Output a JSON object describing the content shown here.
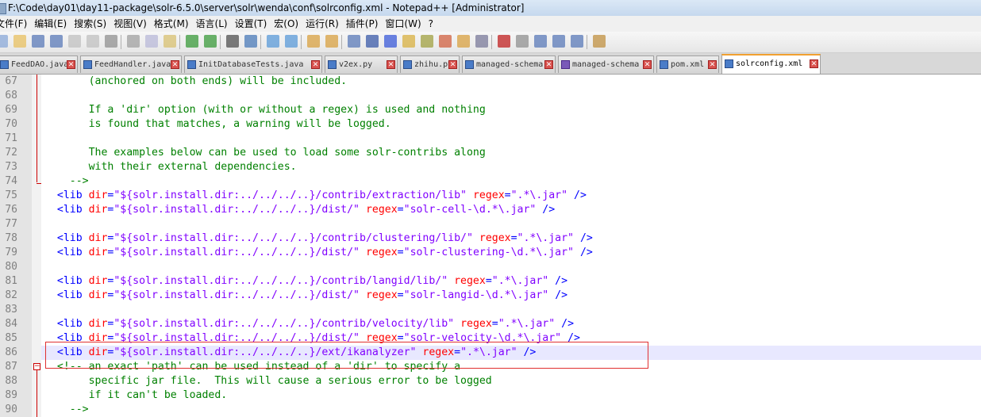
{
  "window": {
    "title": "F:\\Code\\day01\\day11-package\\solr-6.5.0\\server\\solr\\wenda\\conf\\solrconfig.xml - Notepad++ [Administrator]"
  },
  "menu": [
    "文件(F)",
    "编辑(E)",
    "搜索(S)",
    "视图(V)",
    "格式(M)",
    "语言(L)",
    "设置(T)",
    "宏(O)",
    "运行(R)",
    "插件(P)",
    "窗口(W)",
    "?"
  ],
  "toolbar": {
    "icons": [
      "new-file-icon",
      "open-file-icon",
      "save-icon",
      "save-all-icon",
      "close-icon",
      "close-all-icon",
      "print-icon",
      "cut-icon",
      "copy-icon",
      "paste-icon",
      "undo-icon",
      "redo-icon",
      "find-icon",
      "replace-icon",
      "zoom-in-icon",
      "zoom-out-icon",
      "sync-v-icon",
      "sync-h-icon",
      "wrap-icon",
      "all-chars-icon",
      "indent-guide-icon",
      "user-lang-icon",
      "doc-map-icon",
      "function-list-icon",
      "folder-workspace-icon",
      "monitor-icon",
      "record-macro-icon",
      "stop-macro-icon",
      "play-macro-icon",
      "run-macro-icon",
      "save-macro-icon",
      "trim-icon"
    ]
  },
  "tabs": [
    {
      "label": "FeedDAO.java",
      "icon": "save-icon"
    },
    {
      "label": "FeedHandler.java",
      "icon": "save-icon"
    },
    {
      "label": "InitDatabaseTests.java",
      "icon": "save-icon"
    },
    {
      "label": "v2ex.py",
      "icon": "save-icon"
    },
    {
      "label": "zhihu.py",
      "icon": "save-icon"
    },
    {
      "label": "managed-schema",
      "icon": "save-icon"
    },
    {
      "label": "managed-schema",
      "icon": "unsaved-icon"
    },
    {
      "label": "pom.xml",
      "icon": "save-icon"
    },
    {
      "label": "solrconfig.xml",
      "icon": "save-icon"
    }
  ],
  "editor": {
    "lines": [
      {
        "n": "67",
        "segs": [
          {
            "k": "c",
            "t": "       (anchored on both ends) will be included."
          }
        ]
      },
      {
        "n": "68",
        "segs": [
          {
            "k": "c",
            "t": ""
          }
        ]
      },
      {
        "n": "69",
        "segs": [
          {
            "k": "c",
            "t": "       If a 'dir' option (with or without a regex) is used and nothing"
          }
        ]
      },
      {
        "n": "70",
        "segs": [
          {
            "k": "c",
            "t": "       is found that matches, a warning will be logged."
          }
        ]
      },
      {
        "n": "71",
        "segs": [
          {
            "k": "c",
            "t": ""
          }
        ]
      },
      {
        "n": "72",
        "segs": [
          {
            "k": "c",
            "t": "       The examples below can be used to load some solr-contribs along"
          }
        ]
      },
      {
        "n": "73",
        "segs": [
          {
            "k": "c",
            "t": "       with their external dependencies."
          }
        ]
      },
      {
        "n": "74",
        "segs": [
          {
            "k": "c",
            "t": "    -->"
          }
        ]
      },
      {
        "n": "75",
        "segs": [
          {
            "k": "t",
            "t": "  <lib "
          },
          {
            "k": "a",
            "t": "dir"
          },
          {
            "k": "t",
            "t": "="
          },
          {
            "k": "v",
            "t": "\"${solr.install.dir:../../../..}/contrib/extraction/lib\""
          },
          {
            "k": "t",
            "t": " "
          },
          {
            "k": "a",
            "t": "regex"
          },
          {
            "k": "t",
            "t": "="
          },
          {
            "k": "v",
            "t": "\".*\\.jar\""
          },
          {
            "k": "t",
            "t": " />"
          }
        ]
      },
      {
        "n": "76",
        "segs": [
          {
            "k": "t",
            "t": "  <lib "
          },
          {
            "k": "a",
            "t": "dir"
          },
          {
            "k": "t",
            "t": "="
          },
          {
            "k": "v",
            "t": "\"${solr.install.dir:../../../..}/dist/\""
          },
          {
            "k": "t",
            "t": " "
          },
          {
            "k": "a",
            "t": "regex"
          },
          {
            "k": "t",
            "t": "="
          },
          {
            "k": "v",
            "t": "\"solr-cell-\\d.*\\.jar\""
          },
          {
            "k": "t",
            "t": " />"
          }
        ]
      },
      {
        "n": "77",
        "segs": [
          {
            "k": "t",
            "t": ""
          }
        ]
      },
      {
        "n": "78",
        "segs": [
          {
            "k": "t",
            "t": "  <lib "
          },
          {
            "k": "a",
            "t": "dir"
          },
          {
            "k": "t",
            "t": "="
          },
          {
            "k": "v",
            "t": "\"${solr.install.dir:../../../..}/contrib/clustering/lib/\""
          },
          {
            "k": "t",
            "t": " "
          },
          {
            "k": "a",
            "t": "regex"
          },
          {
            "k": "t",
            "t": "="
          },
          {
            "k": "v",
            "t": "\".*\\.jar\""
          },
          {
            "k": "t",
            "t": " />"
          }
        ]
      },
      {
        "n": "79",
        "segs": [
          {
            "k": "t",
            "t": "  <lib "
          },
          {
            "k": "a",
            "t": "dir"
          },
          {
            "k": "t",
            "t": "="
          },
          {
            "k": "v",
            "t": "\"${solr.install.dir:../../../..}/dist/\""
          },
          {
            "k": "t",
            "t": " "
          },
          {
            "k": "a",
            "t": "regex"
          },
          {
            "k": "t",
            "t": "="
          },
          {
            "k": "v",
            "t": "\"solr-clustering-\\d.*\\.jar\""
          },
          {
            "k": "t",
            "t": " />"
          }
        ]
      },
      {
        "n": "80",
        "segs": [
          {
            "k": "t",
            "t": ""
          }
        ]
      },
      {
        "n": "81",
        "segs": [
          {
            "k": "t",
            "t": "  <lib "
          },
          {
            "k": "a",
            "t": "dir"
          },
          {
            "k": "t",
            "t": "="
          },
          {
            "k": "v",
            "t": "\"${solr.install.dir:../../../..}/contrib/langid/lib/\""
          },
          {
            "k": "t",
            "t": " "
          },
          {
            "k": "a",
            "t": "regex"
          },
          {
            "k": "t",
            "t": "="
          },
          {
            "k": "v",
            "t": "\".*\\.jar\""
          },
          {
            "k": "t",
            "t": " />"
          }
        ]
      },
      {
        "n": "82",
        "segs": [
          {
            "k": "t",
            "t": "  <lib "
          },
          {
            "k": "a",
            "t": "dir"
          },
          {
            "k": "t",
            "t": "="
          },
          {
            "k": "v",
            "t": "\"${solr.install.dir:../../../..}/dist/\""
          },
          {
            "k": "t",
            "t": " "
          },
          {
            "k": "a",
            "t": "regex"
          },
          {
            "k": "t",
            "t": "="
          },
          {
            "k": "v",
            "t": "\"solr-langid-\\d.*\\.jar\""
          },
          {
            "k": "t",
            "t": " />"
          }
        ]
      },
      {
        "n": "83",
        "segs": [
          {
            "k": "t",
            "t": ""
          }
        ]
      },
      {
        "n": "84",
        "segs": [
          {
            "k": "t",
            "t": "  <lib "
          },
          {
            "k": "a",
            "t": "dir"
          },
          {
            "k": "t",
            "t": "="
          },
          {
            "k": "v",
            "t": "\"${solr.install.dir:../../../..}/contrib/velocity/lib\""
          },
          {
            "k": "t",
            "t": " "
          },
          {
            "k": "a",
            "t": "regex"
          },
          {
            "k": "t",
            "t": "="
          },
          {
            "k": "v",
            "t": "\".*\\.jar\""
          },
          {
            "k": "t",
            "t": " />"
          }
        ]
      },
      {
        "n": "85",
        "segs": [
          {
            "k": "t",
            "t": "  <lib "
          },
          {
            "k": "a",
            "t": "dir"
          },
          {
            "k": "t",
            "t": "="
          },
          {
            "k": "v",
            "t": "\"${solr.install.dir:../../../..}/dist/\""
          },
          {
            "k": "t",
            "t": " "
          },
          {
            "k": "a",
            "t": "regex"
          },
          {
            "k": "t",
            "t": "="
          },
          {
            "k": "v",
            "t": "\"solr-velocity-\\d.*\\.jar\""
          },
          {
            "k": "t",
            "t": " />"
          }
        ]
      },
      {
        "n": "86",
        "segs": [
          {
            "k": "t",
            "t": "  <lib "
          },
          {
            "k": "a",
            "t": "dir"
          },
          {
            "k": "t",
            "t": "="
          },
          {
            "k": "v",
            "t": "\"${solr.install.dir:../../../..}/ext/ikanalyzer\""
          },
          {
            "k": "t",
            "t": " "
          },
          {
            "k": "a",
            "t": "regex"
          },
          {
            "k": "t",
            "t": "="
          },
          {
            "k": "v",
            "t": "\".*\\.jar\""
          },
          {
            "k": "t",
            "t": " />"
          }
        ]
      },
      {
        "n": "87",
        "segs": [
          {
            "k": "c",
            "t": "  <!-- an exact 'path' can be used instead of a 'dir' to specify a"
          }
        ]
      },
      {
        "n": "88",
        "segs": [
          {
            "k": "c",
            "t": "       specific jar file.  This will cause a serious error to be logged"
          }
        ]
      },
      {
        "n": "89",
        "segs": [
          {
            "k": "c",
            "t": "       if it can't be loaded."
          }
        ]
      },
      {
        "n": "90",
        "segs": [
          {
            "k": "c",
            "t": "    -->"
          }
        ]
      }
    ],
    "current_line": "86"
  },
  "colors": {
    "comment": "#008000",
    "tag": "#0000ff",
    "attr": "#ff0000",
    "value": "#8000ff",
    "active_tab_accent": "#f0a030",
    "annotation_box": "#e03030"
  }
}
